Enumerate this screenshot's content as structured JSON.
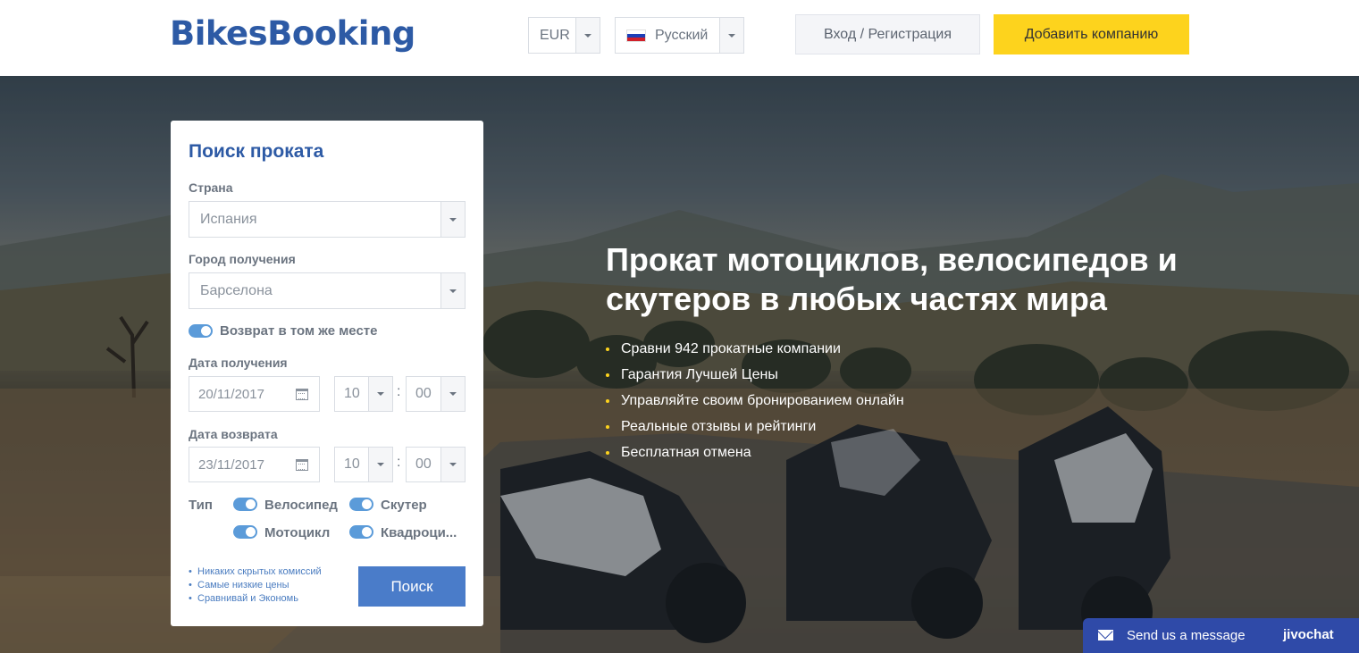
{
  "header": {
    "logo": "BikesBooking",
    "currency": "EUR",
    "language": "Русский",
    "login_label": "Вход / Регистрация",
    "add_company_label": "Добавить компанию"
  },
  "hero": {
    "headline": "Прокат мотоциклов, велосипедов и скутеров в любых частях мира",
    "bullets": [
      "Сравни 942 прокатные компании",
      "Гарантия Лучшей Цены",
      "Управляйте своим бронированием онлайн",
      "Реальные отзывы и рейтинги",
      "Бесплатная отмена"
    ]
  },
  "search": {
    "title": "Поиск проката",
    "country_label": "Страна",
    "country_value": "Испания",
    "city_label": "Город получения",
    "city_value": "Барселона",
    "same_return_label": "Возврат в том же месте",
    "pickup_label": "Дата получения",
    "pickup_date": "20/11/2017",
    "pickup_hour": "10",
    "pickup_minute": "00",
    "return_label": "Дата возврата",
    "return_date": "23/11/2017",
    "return_hour": "10",
    "return_minute": "00",
    "type_label": "Тип",
    "types": [
      "Велосипед",
      "Скутер",
      "Мотоцикл",
      "Квадроци..."
    ],
    "perks": [
      "Никаких скрытых комиссий",
      "Самые низкие цены",
      "Сравнивай и Экономь"
    ],
    "search_button": "Поиск"
  },
  "chat": {
    "label": "Send us a message",
    "brand": "jivochat"
  },
  "colors": {
    "brand_blue": "#2d5aa5",
    "accent_yellow": "#fdd31d",
    "button_blue": "#4a7cc9",
    "chat_blue": "#2f4aa8"
  }
}
